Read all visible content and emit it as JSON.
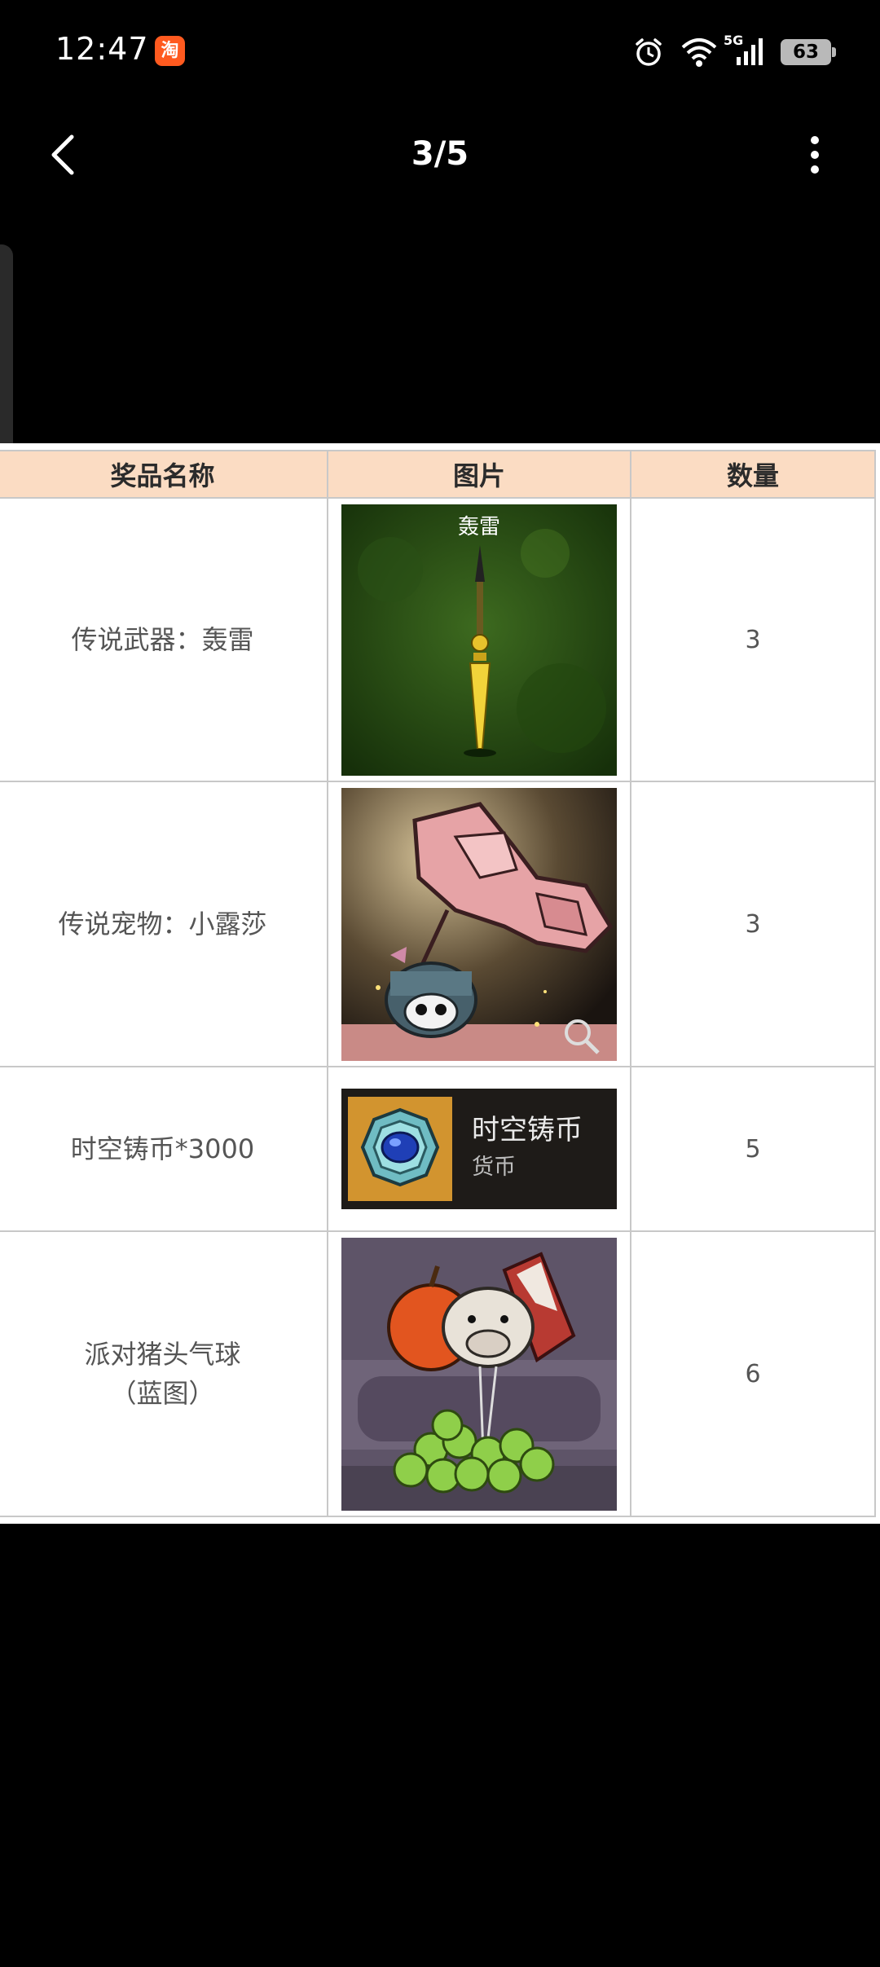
{
  "status_bar": {
    "time": "12:47",
    "app_badge": "淘",
    "network_label": "5G",
    "battery": "63"
  },
  "viewer": {
    "page_counter": "3/5"
  },
  "table": {
    "headers": [
      "奖品名称",
      "图片",
      "数量"
    ],
    "rows": [
      {
        "name": "传说武器：轰雷",
        "image_caption": "轰雷",
        "quantity": "3",
        "image_icon": "golden-spear-icon"
      },
      {
        "name": "传说宠物：小露莎",
        "quantity": "3",
        "image_icon": "pet-girl-umbrella-icon"
      },
      {
        "name": "时空铸币*3000",
        "coin_title": "时空铸币",
        "coin_subtitle": "货币",
        "quantity": "5",
        "image_icon": "spacetime-coin-icon"
      },
      {
        "name_line1": "派对猪头气球",
        "name_line2": "（蓝图）",
        "quantity": "6",
        "image_icon": "pig-head-balloon-icon"
      }
    ]
  },
  "colors": {
    "header_bg": "#fbdcc3",
    "table_border": "#c8c8c8",
    "background": "#000000"
  }
}
